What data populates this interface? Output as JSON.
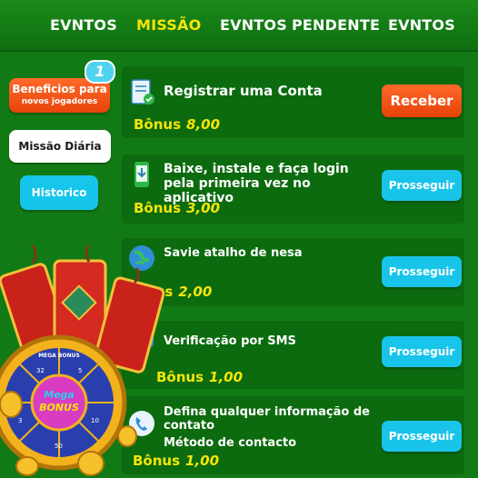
{
  "tabs": [
    {
      "label": "EVNTOS",
      "active": false
    },
    {
      "label": "MISSÃO",
      "active": true
    },
    {
      "label": "EVNTOS",
      "active": false
    },
    {
      "label": "PENDENTE",
      "active": false
    },
    {
      "label": "EVNTOS",
      "active": false
    }
  ],
  "sidebar": {
    "benefits_line1": "Beneficios para",
    "benefits_line2": "novos jogadores",
    "badge": "1",
    "daily": "Missão Diária",
    "history": "Historico"
  },
  "missions": [
    {
      "title": "Registrar uma Conta",
      "bonus_label": "Bônus",
      "bonus_value": "8,00",
      "button": "Receber",
      "icon": "document-check-icon"
    },
    {
      "title": "Baixe, instale e faça login pela primeira vez no aplicativo",
      "bonus_label": "Bônus",
      "bonus_value": "3,00",
      "button": "Prosseguir",
      "icon": "phone-download-icon"
    },
    {
      "title": "Savie atalho de nesa",
      "bonus_label": "nus",
      "bonus_value": "2,00",
      "button": "Prosseguir",
      "icon": "globe-icon"
    },
    {
      "title": "Verificação por SMS",
      "bonus_label": "Bônus",
      "bonus_value": "1,00",
      "button": "Prosseguir",
      "icon": "sms-icon"
    },
    {
      "title": "Defina qualquer informação de contato",
      "subtitle": "Método de contacto",
      "bonus_label": "Bônus",
      "bonus_value": "1,00",
      "button": "Prosseguir",
      "icon": "phone-icon"
    }
  ],
  "promo": {
    "wheel_text": "Mega Bonus",
    "wheel_top": "MEGA BONUS",
    "wheel_numbers": [
      "32",
      "5",
      "10",
      "3",
      "50"
    ]
  },
  "colors": {
    "accent_yellow": "#f5e50a",
    "orange": "#ff6a2a",
    "cyan": "#19c4ea",
    "bg_green": "#127a14"
  }
}
